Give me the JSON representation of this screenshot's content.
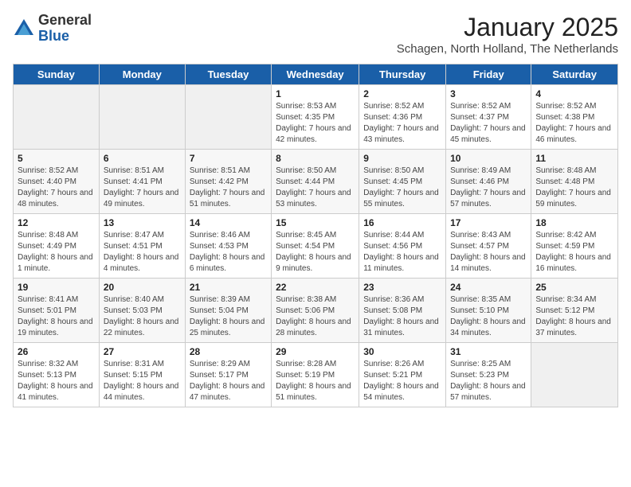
{
  "logo": {
    "general": "General",
    "blue": "Blue"
  },
  "header": {
    "month": "January 2025",
    "location": "Schagen, North Holland, The Netherlands"
  },
  "weekdays": [
    "Sunday",
    "Monday",
    "Tuesday",
    "Wednesday",
    "Thursday",
    "Friday",
    "Saturday"
  ],
  "weeks": [
    [
      {
        "day": "",
        "sunrise": "",
        "sunset": "",
        "daylight": ""
      },
      {
        "day": "",
        "sunrise": "",
        "sunset": "",
        "daylight": ""
      },
      {
        "day": "",
        "sunrise": "",
        "sunset": "",
        "daylight": ""
      },
      {
        "day": "1",
        "sunrise": "Sunrise: 8:53 AM",
        "sunset": "Sunset: 4:35 PM",
        "daylight": "Daylight: 7 hours and 42 minutes."
      },
      {
        "day": "2",
        "sunrise": "Sunrise: 8:52 AM",
        "sunset": "Sunset: 4:36 PM",
        "daylight": "Daylight: 7 hours and 43 minutes."
      },
      {
        "day": "3",
        "sunrise": "Sunrise: 8:52 AM",
        "sunset": "Sunset: 4:37 PM",
        "daylight": "Daylight: 7 hours and 45 minutes."
      },
      {
        "day": "4",
        "sunrise": "Sunrise: 8:52 AM",
        "sunset": "Sunset: 4:38 PM",
        "daylight": "Daylight: 7 hours and 46 minutes."
      }
    ],
    [
      {
        "day": "5",
        "sunrise": "Sunrise: 8:52 AM",
        "sunset": "Sunset: 4:40 PM",
        "daylight": "Daylight: 7 hours and 48 minutes."
      },
      {
        "day": "6",
        "sunrise": "Sunrise: 8:51 AM",
        "sunset": "Sunset: 4:41 PM",
        "daylight": "Daylight: 7 hours and 49 minutes."
      },
      {
        "day": "7",
        "sunrise": "Sunrise: 8:51 AM",
        "sunset": "Sunset: 4:42 PM",
        "daylight": "Daylight: 7 hours and 51 minutes."
      },
      {
        "day": "8",
        "sunrise": "Sunrise: 8:50 AM",
        "sunset": "Sunset: 4:44 PM",
        "daylight": "Daylight: 7 hours and 53 minutes."
      },
      {
        "day": "9",
        "sunrise": "Sunrise: 8:50 AM",
        "sunset": "Sunset: 4:45 PM",
        "daylight": "Daylight: 7 hours and 55 minutes."
      },
      {
        "day": "10",
        "sunrise": "Sunrise: 8:49 AM",
        "sunset": "Sunset: 4:46 PM",
        "daylight": "Daylight: 7 hours and 57 minutes."
      },
      {
        "day": "11",
        "sunrise": "Sunrise: 8:48 AM",
        "sunset": "Sunset: 4:48 PM",
        "daylight": "Daylight: 7 hours and 59 minutes."
      }
    ],
    [
      {
        "day": "12",
        "sunrise": "Sunrise: 8:48 AM",
        "sunset": "Sunset: 4:49 PM",
        "daylight": "Daylight: 8 hours and 1 minute."
      },
      {
        "day": "13",
        "sunrise": "Sunrise: 8:47 AM",
        "sunset": "Sunset: 4:51 PM",
        "daylight": "Daylight: 8 hours and 4 minutes."
      },
      {
        "day": "14",
        "sunrise": "Sunrise: 8:46 AM",
        "sunset": "Sunset: 4:53 PM",
        "daylight": "Daylight: 8 hours and 6 minutes."
      },
      {
        "day": "15",
        "sunrise": "Sunrise: 8:45 AM",
        "sunset": "Sunset: 4:54 PM",
        "daylight": "Daylight: 8 hours and 9 minutes."
      },
      {
        "day": "16",
        "sunrise": "Sunrise: 8:44 AM",
        "sunset": "Sunset: 4:56 PM",
        "daylight": "Daylight: 8 hours and 11 minutes."
      },
      {
        "day": "17",
        "sunrise": "Sunrise: 8:43 AM",
        "sunset": "Sunset: 4:57 PM",
        "daylight": "Daylight: 8 hours and 14 minutes."
      },
      {
        "day": "18",
        "sunrise": "Sunrise: 8:42 AM",
        "sunset": "Sunset: 4:59 PM",
        "daylight": "Daylight: 8 hours and 16 minutes."
      }
    ],
    [
      {
        "day": "19",
        "sunrise": "Sunrise: 8:41 AM",
        "sunset": "Sunset: 5:01 PM",
        "daylight": "Daylight: 8 hours and 19 minutes."
      },
      {
        "day": "20",
        "sunrise": "Sunrise: 8:40 AM",
        "sunset": "Sunset: 5:03 PM",
        "daylight": "Daylight: 8 hours and 22 minutes."
      },
      {
        "day": "21",
        "sunrise": "Sunrise: 8:39 AM",
        "sunset": "Sunset: 5:04 PM",
        "daylight": "Daylight: 8 hours and 25 minutes."
      },
      {
        "day": "22",
        "sunrise": "Sunrise: 8:38 AM",
        "sunset": "Sunset: 5:06 PM",
        "daylight": "Daylight: 8 hours and 28 minutes."
      },
      {
        "day": "23",
        "sunrise": "Sunrise: 8:36 AM",
        "sunset": "Sunset: 5:08 PM",
        "daylight": "Daylight: 8 hours and 31 minutes."
      },
      {
        "day": "24",
        "sunrise": "Sunrise: 8:35 AM",
        "sunset": "Sunset: 5:10 PM",
        "daylight": "Daylight: 8 hours and 34 minutes."
      },
      {
        "day": "25",
        "sunrise": "Sunrise: 8:34 AM",
        "sunset": "Sunset: 5:12 PM",
        "daylight": "Daylight: 8 hours and 37 minutes."
      }
    ],
    [
      {
        "day": "26",
        "sunrise": "Sunrise: 8:32 AM",
        "sunset": "Sunset: 5:13 PM",
        "daylight": "Daylight: 8 hours and 41 minutes."
      },
      {
        "day": "27",
        "sunrise": "Sunrise: 8:31 AM",
        "sunset": "Sunset: 5:15 PM",
        "daylight": "Daylight: 8 hours and 44 minutes."
      },
      {
        "day": "28",
        "sunrise": "Sunrise: 8:29 AM",
        "sunset": "Sunset: 5:17 PM",
        "daylight": "Daylight: 8 hours and 47 minutes."
      },
      {
        "day": "29",
        "sunrise": "Sunrise: 8:28 AM",
        "sunset": "Sunset: 5:19 PM",
        "daylight": "Daylight: 8 hours and 51 minutes."
      },
      {
        "day": "30",
        "sunrise": "Sunrise: 8:26 AM",
        "sunset": "Sunset: 5:21 PM",
        "daylight": "Daylight: 8 hours and 54 minutes."
      },
      {
        "day": "31",
        "sunrise": "Sunrise: 8:25 AM",
        "sunset": "Sunset: 5:23 PM",
        "daylight": "Daylight: 8 hours and 57 minutes."
      },
      {
        "day": "",
        "sunrise": "",
        "sunset": "",
        "daylight": ""
      }
    ]
  ]
}
